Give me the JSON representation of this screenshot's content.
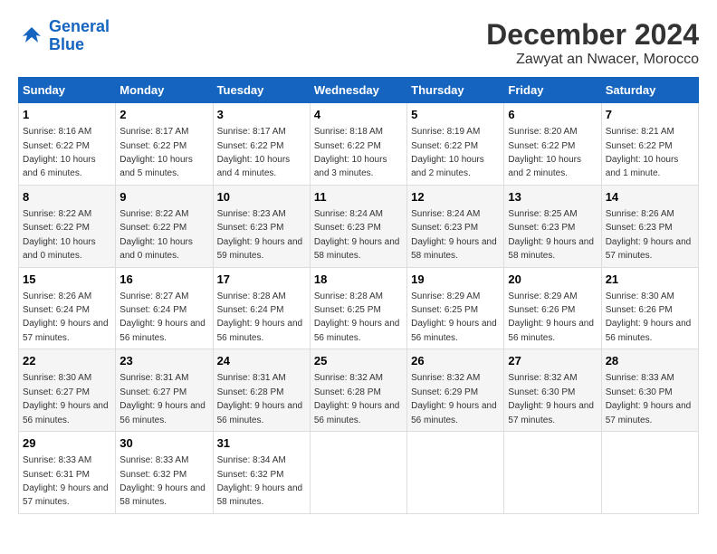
{
  "logo": {
    "line1": "General",
    "line2": "Blue"
  },
  "title": "December 2024",
  "subtitle": "Zawyat an Nwacer, Morocco",
  "days_of_week": [
    "Sunday",
    "Monday",
    "Tuesday",
    "Wednesday",
    "Thursday",
    "Friday",
    "Saturday"
  ],
  "weeks": [
    [
      {
        "day": "1",
        "sunrise": "Sunrise: 8:16 AM",
        "sunset": "Sunset: 6:22 PM",
        "daylight": "Daylight: 10 hours and 6 minutes."
      },
      {
        "day": "2",
        "sunrise": "Sunrise: 8:17 AM",
        "sunset": "Sunset: 6:22 PM",
        "daylight": "Daylight: 10 hours and 5 minutes."
      },
      {
        "day": "3",
        "sunrise": "Sunrise: 8:17 AM",
        "sunset": "Sunset: 6:22 PM",
        "daylight": "Daylight: 10 hours and 4 minutes."
      },
      {
        "day": "4",
        "sunrise": "Sunrise: 8:18 AM",
        "sunset": "Sunset: 6:22 PM",
        "daylight": "Daylight: 10 hours and 3 minutes."
      },
      {
        "day": "5",
        "sunrise": "Sunrise: 8:19 AM",
        "sunset": "Sunset: 6:22 PM",
        "daylight": "Daylight: 10 hours and 2 minutes."
      },
      {
        "day": "6",
        "sunrise": "Sunrise: 8:20 AM",
        "sunset": "Sunset: 6:22 PM",
        "daylight": "Daylight: 10 hours and 2 minutes."
      },
      {
        "day": "7",
        "sunrise": "Sunrise: 8:21 AM",
        "sunset": "Sunset: 6:22 PM",
        "daylight": "Daylight: 10 hours and 1 minute."
      }
    ],
    [
      {
        "day": "8",
        "sunrise": "Sunrise: 8:22 AM",
        "sunset": "Sunset: 6:22 PM",
        "daylight": "Daylight: 10 hours and 0 minutes."
      },
      {
        "day": "9",
        "sunrise": "Sunrise: 8:22 AM",
        "sunset": "Sunset: 6:22 PM",
        "daylight": "Daylight: 10 hours and 0 minutes."
      },
      {
        "day": "10",
        "sunrise": "Sunrise: 8:23 AM",
        "sunset": "Sunset: 6:23 PM",
        "daylight": "Daylight: 9 hours and 59 minutes."
      },
      {
        "day": "11",
        "sunrise": "Sunrise: 8:24 AM",
        "sunset": "Sunset: 6:23 PM",
        "daylight": "Daylight: 9 hours and 58 minutes."
      },
      {
        "day": "12",
        "sunrise": "Sunrise: 8:24 AM",
        "sunset": "Sunset: 6:23 PM",
        "daylight": "Daylight: 9 hours and 58 minutes."
      },
      {
        "day": "13",
        "sunrise": "Sunrise: 8:25 AM",
        "sunset": "Sunset: 6:23 PM",
        "daylight": "Daylight: 9 hours and 58 minutes."
      },
      {
        "day": "14",
        "sunrise": "Sunrise: 8:26 AM",
        "sunset": "Sunset: 6:23 PM",
        "daylight": "Daylight: 9 hours and 57 minutes."
      }
    ],
    [
      {
        "day": "15",
        "sunrise": "Sunrise: 8:26 AM",
        "sunset": "Sunset: 6:24 PM",
        "daylight": "Daylight: 9 hours and 57 minutes."
      },
      {
        "day": "16",
        "sunrise": "Sunrise: 8:27 AM",
        "sunset": "Sunset: 6:24 PM",
        "daylight": "Daylight: 9 hours and 56 minutes."
      },
      {
        "day": "17",
        "sunrise": "Sunrise: 8:28 AM",
        "sunset": "Sunset: 6:24 PM",
        "daylight": "Daylight: 9 hours and 56 minutes."
      },
      {
        "day": "18",
        "sunrise": "Sunrise: 8:28 AM",
        "sunset": "Sunset: 6:25 PM",
        "daylight": "Daylight: 9 hours and 56 minutes."
      },
      {
        "day": "19",
        "sunrise": "Sunrise: 8:29 AM",
        "sunset": "Sunset: 6:25 PM",
        "daylight": "Daylight: 9 hours and 56 minutes."
      },
      {
        "day": "20",
        "sunrise": "Sunrise: 8:29 AM",
        "sunset": "Sunset: 6:26 PM",
        "daylight": "Daylight: 9 hours and 56 minutes."
      },
      {
        "day": "21",
        "sunrise": "Sunrise: 8:30 AM",
        "sunset": "Sunset: 6:26 PM",
        "daylight": "Daylight: 9 hours and 56 minutes."
      }
    ],
    [
      {
        "day": "22",
        "sunrise": "Sunrise: 8:30 AM",
        "sunset": "Sunset: 6:27 PM",
        "daylight": "Daylight: 9 hours and 56 minutes."
      },
      {
        "day": "23",
        "sunrise": "Sunrise: 8:31 AM",
        "sunset": "Sunset: 6:27 PM",
        "daylight": "Daylight: 9 hours and 56 minutes."
      },
      {
        "day": "24",
        "sunrise": "Sunrise: 8:31 AM",
        "sunset": "Sunset: 6:28 PM",
        "daylight": "Daylight: 9 hours and 56 minutes."
      },
      {
        "day": "25",
        "sunrise": "Sunrise: 8:32 AM",
        "sunset": "Sunset: 6:28 PM",
        "daylight": "Daylight: 9 hours and 56 minutes."
      },
      {
        "day": "26",
        "sunrise": "Sunrise: 8:32 AM",
        "sunset": "Sunset: 6:29 PM",
        "daylight": "Daylight: 9 hours and 56 minutes."
      },
      {
        "day": "27",
        "sunrise": "Sunrise: 8:32 AM",
        "sunset": "Sunset: 6:30 PM",
        "daylight": "Daylight: 9 hours and 57 minutes."
      },
      {
        "day": "28",
        "sunrise": "Sunrise: 8:33 AM",
        "sunset": "Sunset: 6:30 PM",
        "daylight": "Daylight: 9 hours and 57 minutes."
      }
    ],
    [
      {
        "day": "29",
        "sunrise": "Sunrise: 8:33 AM",
        "sunset": "Sunset: 6:31 PM",
        "daylight": "Daylight: 9 hours and 57 minutes."
      },
      {
        "day": "30",
        "sunrise": "Sunrise: 8:33 AM",
        "sunset": "Sunset: 6:32 PM",
        "daylight": "Daylight: 9 hours and 58 minutes."
      },
      {
        "day": "31",
        "sunrise": "Sunrise: 8:34 AM",
        "sunset": "Sunset: 6:32 PM",
        "daylight": "Daylight: 9 hours and 58 minutes."
      },
      null,
      null,
      null,
      null
    ]
  ]
}
